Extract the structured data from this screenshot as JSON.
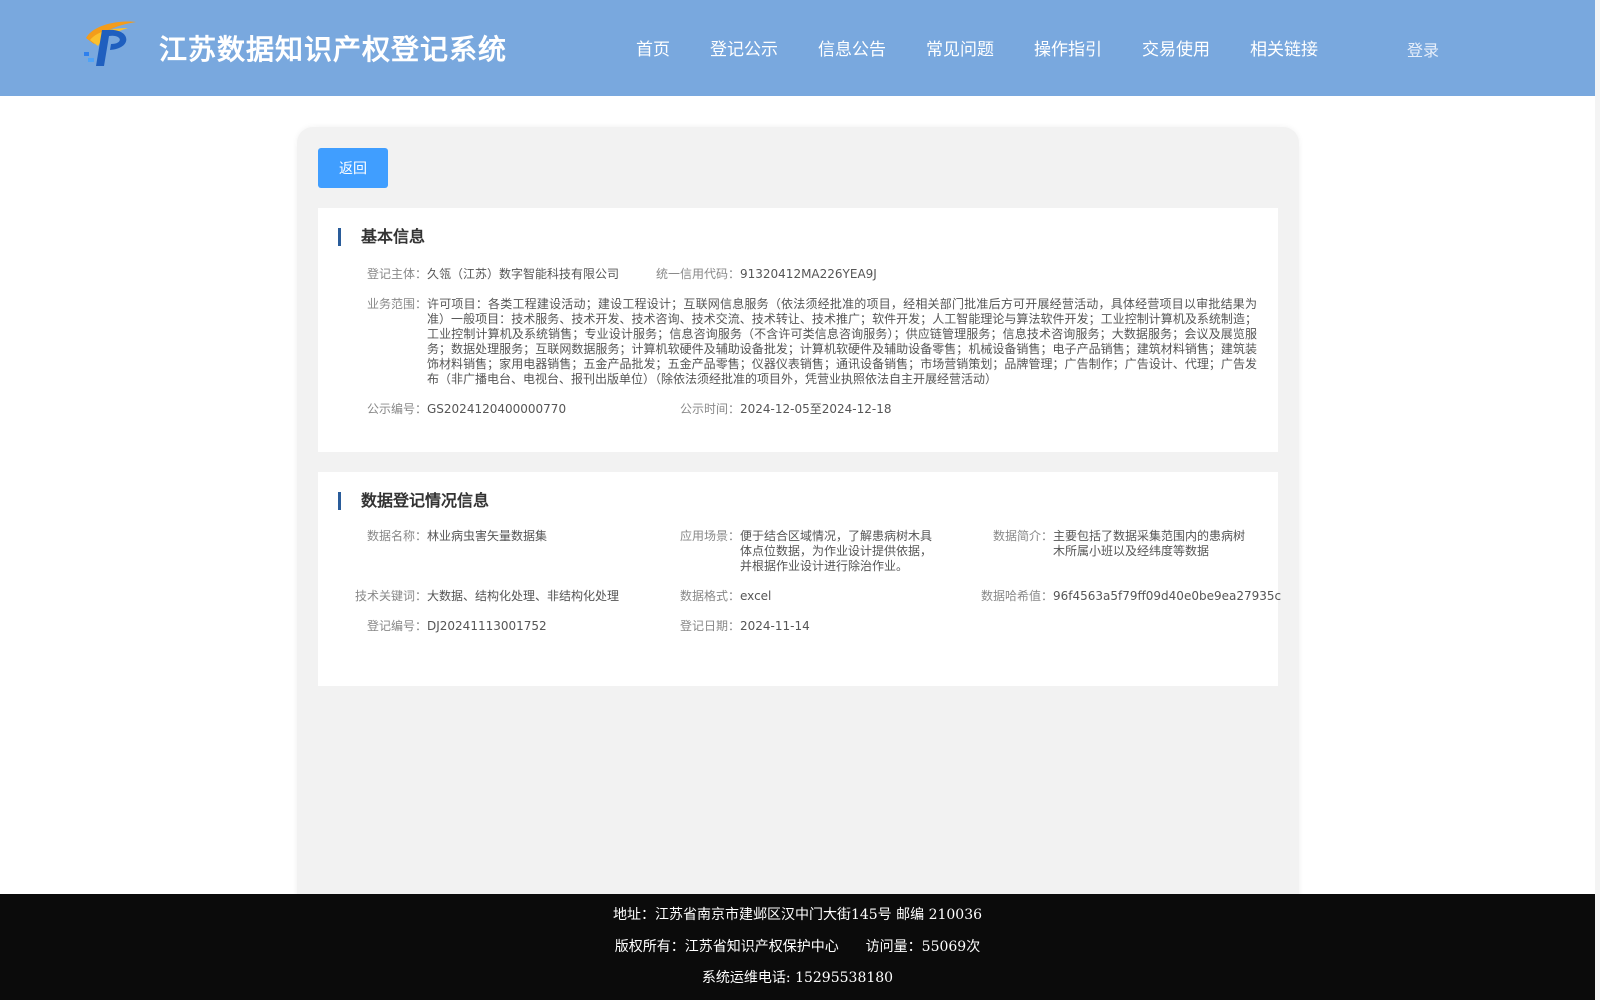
{
  "header": {
    "site_title": "江苏数据知识产权登记系统",
    "nav": [
      "首页",
      "登记公示",
      "信息公告",
      "常见问题",
      "操作指引",
      "交易使用",
      "相关链接"
    ],
    "login": "登录",
    "logo_icon": "ip-logo-icon",
    "colors": {
      "header_bg": "#79a8de",
      "accent": "#409eff"
    }
  },
  "back_label": "返回",
  "basic": {
    "title": "基本信息",
    "subject_label": "登记主体：",
    "subject": "久瓴（江苏）数字智能科技有限公司",
    "credit_label": "统一信用代码：",
    "credit": "91320412MA226YEA9J",
    "scope_label": "业务范围：",
    "scope": "许可项目：各类工程建设活动；建设工程设计；互联网信息服务（依法须经批准的项目，经相关部门批准后方可开展经营活动，具体经营项目以审批结果为准）一般项目：技术服务、技术开发、技术咨询、技术交流、技术转让、技术推广；软件开发；人工智能理论与算法软件开发；工业控制计算机及系统制造；工业控制计算机及系统销售；专业设计服务；信息咨询服务（不含许可类信息咨询服务）；供应链管理服务；信息技术咨询服务；大数据服务；会议及展览服务；数据处理服务；互联网数据服务；计算机软硬件及辅助设备批发；计算机软硬件及辅助设备零售；机械设备销售；电子产品销售；建筑材料销售；建筑装饰材料销售；家用电器销售；五金产品批发；五金产品零售；仪器仪表销售；通讯设备销售；市场营销策划；品牌管理；广告制作；广告设计、代理；广告发布（非广播电台、电视台、报刊出版单位）（除依法须经批准的项目外，凭营业执照依法自主开展经营活动）",
    "pub_no_label": "公示编号：",
    "pub_no": "GS2024120400000770",
    "pub_time_label": "公示时间：",
    "pub_time": "2024-12-05至2024-12-18"
  },
  "data_reg": {
    "title": "数据登记情况信息",
    "name_label": "数据名称：",
    "name": "林业病虫害矢量数据集",
    "scene_label": "应用场景：",
    "scene": "便于结合区域情况，了解患病树木具体点位数据，为作业设计提供依据，并根据作业设计进行除治作业。",
    "intro_label": "数据简介：",
    "intro": "主要包括了数据采集范围内的患病树木所属小班以及经纬度等数据",
    "keywords_label": "技术关键词：",
    "keywords": "大数据、结构化处理、非结构化处理",
    "format_label": "数据格式：",
    "format": "excel",
    "hash_label": "数据哈希值：",
    "hash": "96f4563a5f79ff09d40e0be9ea27935c",
    "reg_no_label": "登记编号：",
    "reg_no": "DJ20241113001752",
    "reg_date_label": "登记日期：",
    "reg_date": "2024-11-14"
  },
  "footer": {
    "address": "地址：江苏省南京市建邺区汉中门大街145号 邮编 210036",
    "copyright": "版权所有：江苏省知识产权保护中心",
    "visits": "访问量：55069次",
    "phone": "系统运维电话: 15295538180"
  }
}
